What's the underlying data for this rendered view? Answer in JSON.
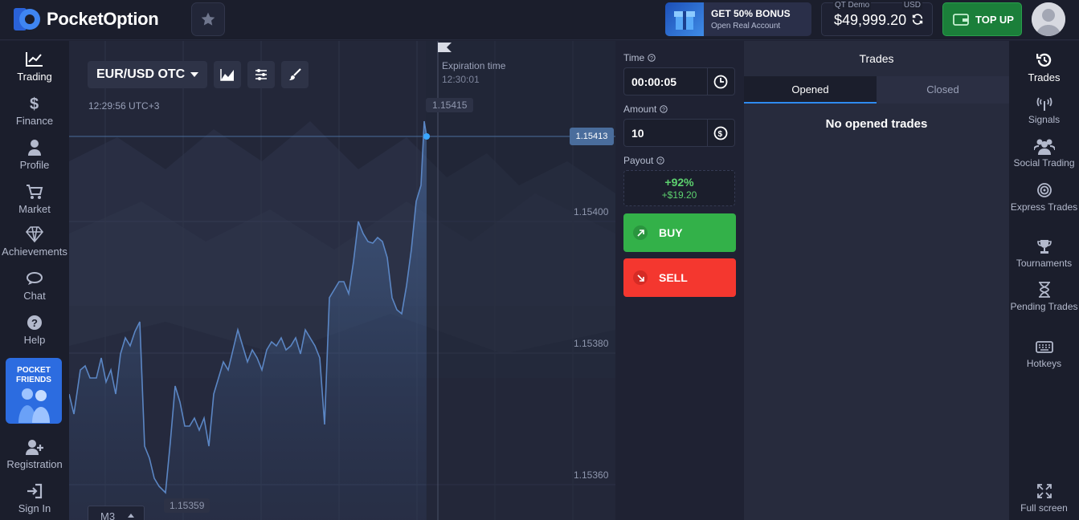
{
  "header": {
    "logo_text": "PocketOption",
    "bonus_title": "GET 50% BONUS",
    "bonus_subtitle": "Open Real Account",
    "account_label": "QT Demo",
    "currency": "USD",
    "balance": "$49,999.20",
    "topup_label": "TOP UP"
  },
  "left_nav": {
    "items": [
      {
        "label": "Trading",
        "icon": "chart-line-icon"
      },
      {
        "label": "Finance",
        "icon": "dollar-icon"
      },
      {
        "label": "Profile",
        "icon": "user-icon"
      },
      {
        "label": "Market",
        "icon": "cart-icon"
      },
      {
        "label": "Achievements",
        "icon": "diamond-icon"
      },
      {
        "label": "Chat",
        "icon": "chat-icon"
      },
      {
        "label": "Help",
        "icon": "help-icon"
      },
      {
        "label": "Registration",
        "icon": "add-user-icon"
      },
      {
        "label": "Sign In",
        "icon": "sign-in-icon"
      }
    ],
    "friends_banner": "POCKET FRIENDS"
  },
  "chart": {
    "pair": "EUR/USD OTC",
    "server_time": "12:29:56 UTC+3",
    "expiration_label": "Expiration time",
    "expiration_time": "12:30:01",
    "current_price": "1.15413",
    "peak_price": "1.15415",
    "low_price": "1.15359",
    "price_levels": [
      "1.15400",
      "1.15380",
      "1.15360"
    ],
    "timeframe": "M3"
  },
  "trade_panel": {
    "time_label": "Time",
    "time_value": "00:00:05",
    "amount_label": "Amount",
    "amount_value": "10",
    "payout_label": "Payout",
    "payout_percent": "+92%",
    "payout_amount": "+$19.20",
    "buy_label": "BUY",
    "sell_label": "SELL"
  },
  "trades_panel": {
    "title": "Trades",
    "tabs": [
      "Opened",
      "Closed"
    ],
    "empty_message": "No opened trades"
  },
  "right_nav": {
    "items": [
      {
        "label": "Trades",
        "icon": "history-icon"
      },
      {
        "label": "Signals",
        "icon": "signal-icon"
      },
      {
        "label": "Social Trading",
        "icon": "users-icon"
      },
      {
        "label": "Express Trades",
        "icon": "target-icon"
      },
      {
        "label": "Tournaments",
        "icon": "trophy-icon"
      },
      {
        "label": "Pending Trades",
        "icon": "hourglass-icon"
      },
      {
        "label": "Hotkeys",
        "icon": "keyboard-icon"
      },
      {
        "label": "Full screen",
        "icon": "fullscreen-icon"
      }
    ]
  },
  "colors": {
    "buy": "#33b149",
    "sell": "#f4372f",
    "accent": "#2e8bf0",
    "line": "#5b86c4"
  }
}
